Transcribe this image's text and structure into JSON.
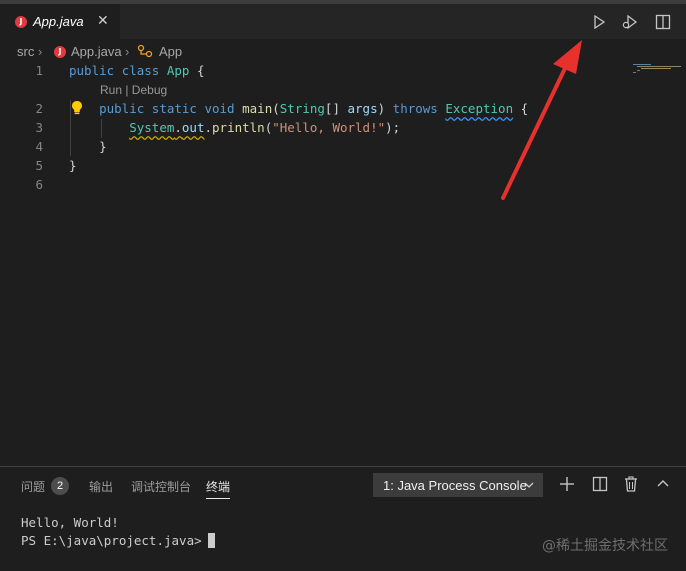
{
  "editor": {
    "tab": {
      "title": "App.java",
      "badge": "J",
      "close": "✕"
    },
    "breadcrumb": {
      "folder": "src",
      "sep": "›",
      "file": "App.java",
      "symbol": "App"
    },
    "codelens": "Run | Debug",
    "line_numbers": [
      "1",
      "2",
      "3",
      "4",
      "5",
      "6"
    ],
    "code": {
      "l1": {
        "kw1": "public",
        "kw2": "class",
        "name": "App",
        "brace": " {"
      },
      "l2": {
        "kw1": "public",
        "kw2": "static",
        "kw3": "void",
        "fn": "main",
        "p1": "(",
        "type": "String",
        "arr": "[] ",
        "param": "args",
        "p2": ") ",
        "throws": "throws",
        "exc": "Exception",
        "brace": " {"
      },
      "l3": {
        "cls": "System",
        "dot1": ".",
        "field": "out",
        "dot2": ".",
        "fn": "println",
        "p1": "(",
        "str": "\"Hello, World!\"",
        "p2": ");"
      },
      "l4": "}",
      "l5": "}"
    }
  },
  "panel": {
    "tabs": [
      "问题",
      "输出",
      "调试控制台",
      "终端"
    ],
    "problems_count": "2",
    "terminal_select": "1: Java Process Console",
    "terminal_lines": [
      "Hello, World!",
      "PS E:\\java\\project.java>"
    ]
  },
  "watermark": "@稀土掘金技术社区",
  "colors": {
    "accent_arrow": "#e8312c",
    "java_badge": "#e0393e"
  }
}
